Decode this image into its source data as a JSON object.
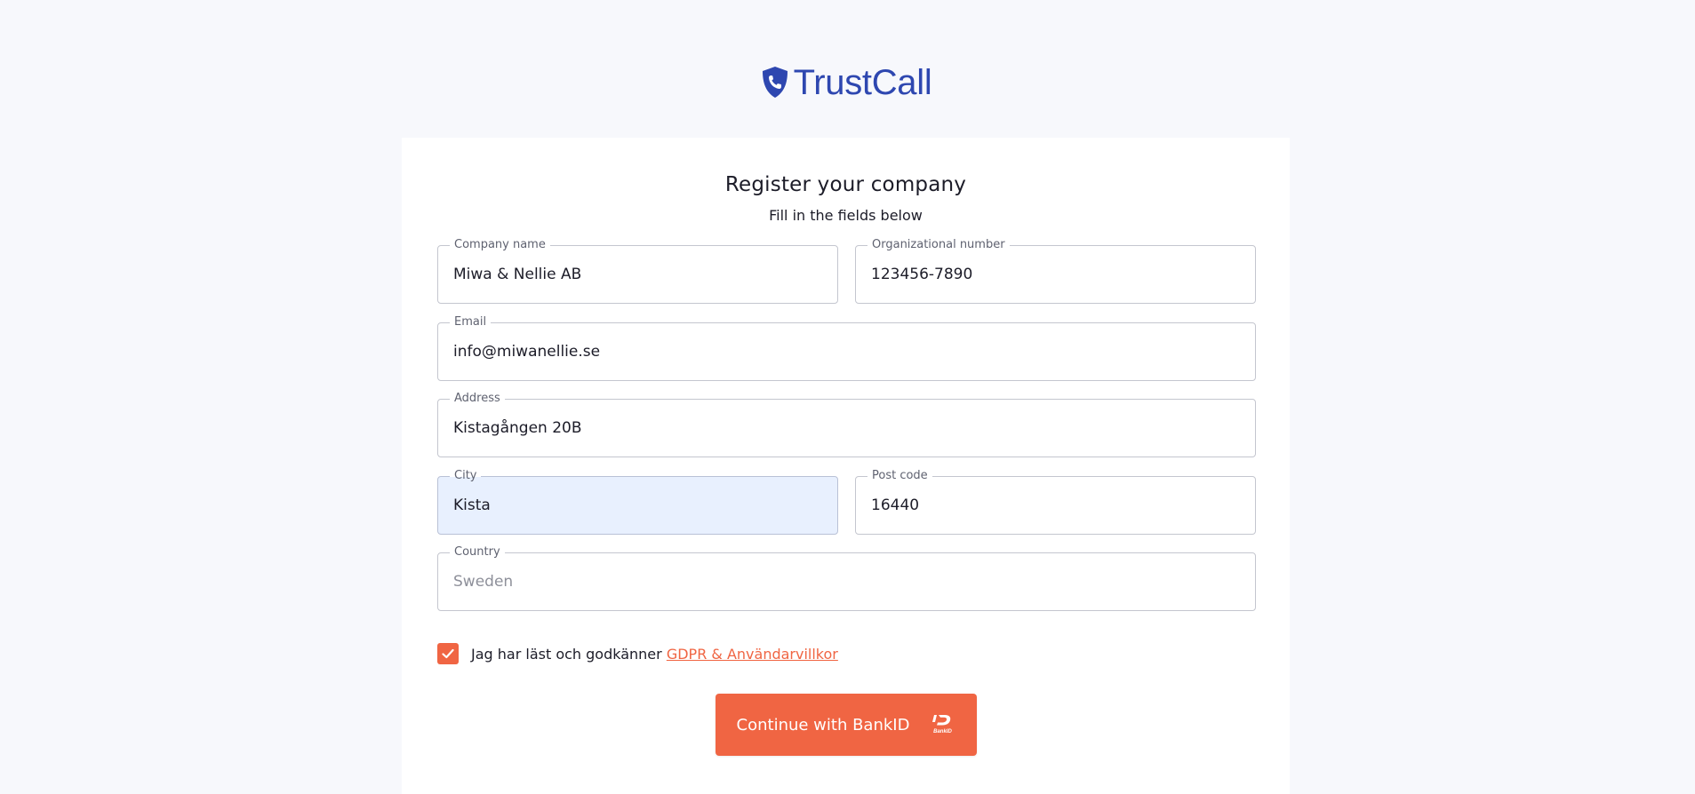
{
  "brand": {
    "name": "TrustCall",
    "color": "#2e47b0",
    "icon": "shield-phone-icon"
  },
  "form": {
    "title": "Register your company",
    "subtitle": "Fill in the fields below",
    "fields": {
      "company_name": {
        "label": "Company name",
        "value": "Miwa & Nellie AB"
      },
      "org_number": {
        "label": "Organizational number",
        "value": "123456-7890"
      },
      "email": {
        "label": "Email",
        "value": "info@miwanellie.se"
      },
      "address": {
        "label": "Address",
        "value": "Kistagången 20B"
      },
      "city": {
        "label": "City",
        "value": "Kista"
      },
      "post_code": {
        "label": "Post code",
        "value": "16440"
      },
      "country": {
        "label": "Country",
        "value": "",
        "placeholder": "Sweden"
      }
    },
    "consent": {
      "checked": true,
      "text": "Jag har läst och godkänner",
      "link_text": "GDPR & Användarvillkor"
    },
    "submit": {
      "label": "Continue with BankID",
      "logo_text": "BankID",
      "icon": "bankid-icon"
    }
  },
  "colors": {
    "accent": "#f06543",
    "background": "#f7f8fc",
    "card": "#ffffff",
    "autofill": "#e8f0fe"
  }
}
